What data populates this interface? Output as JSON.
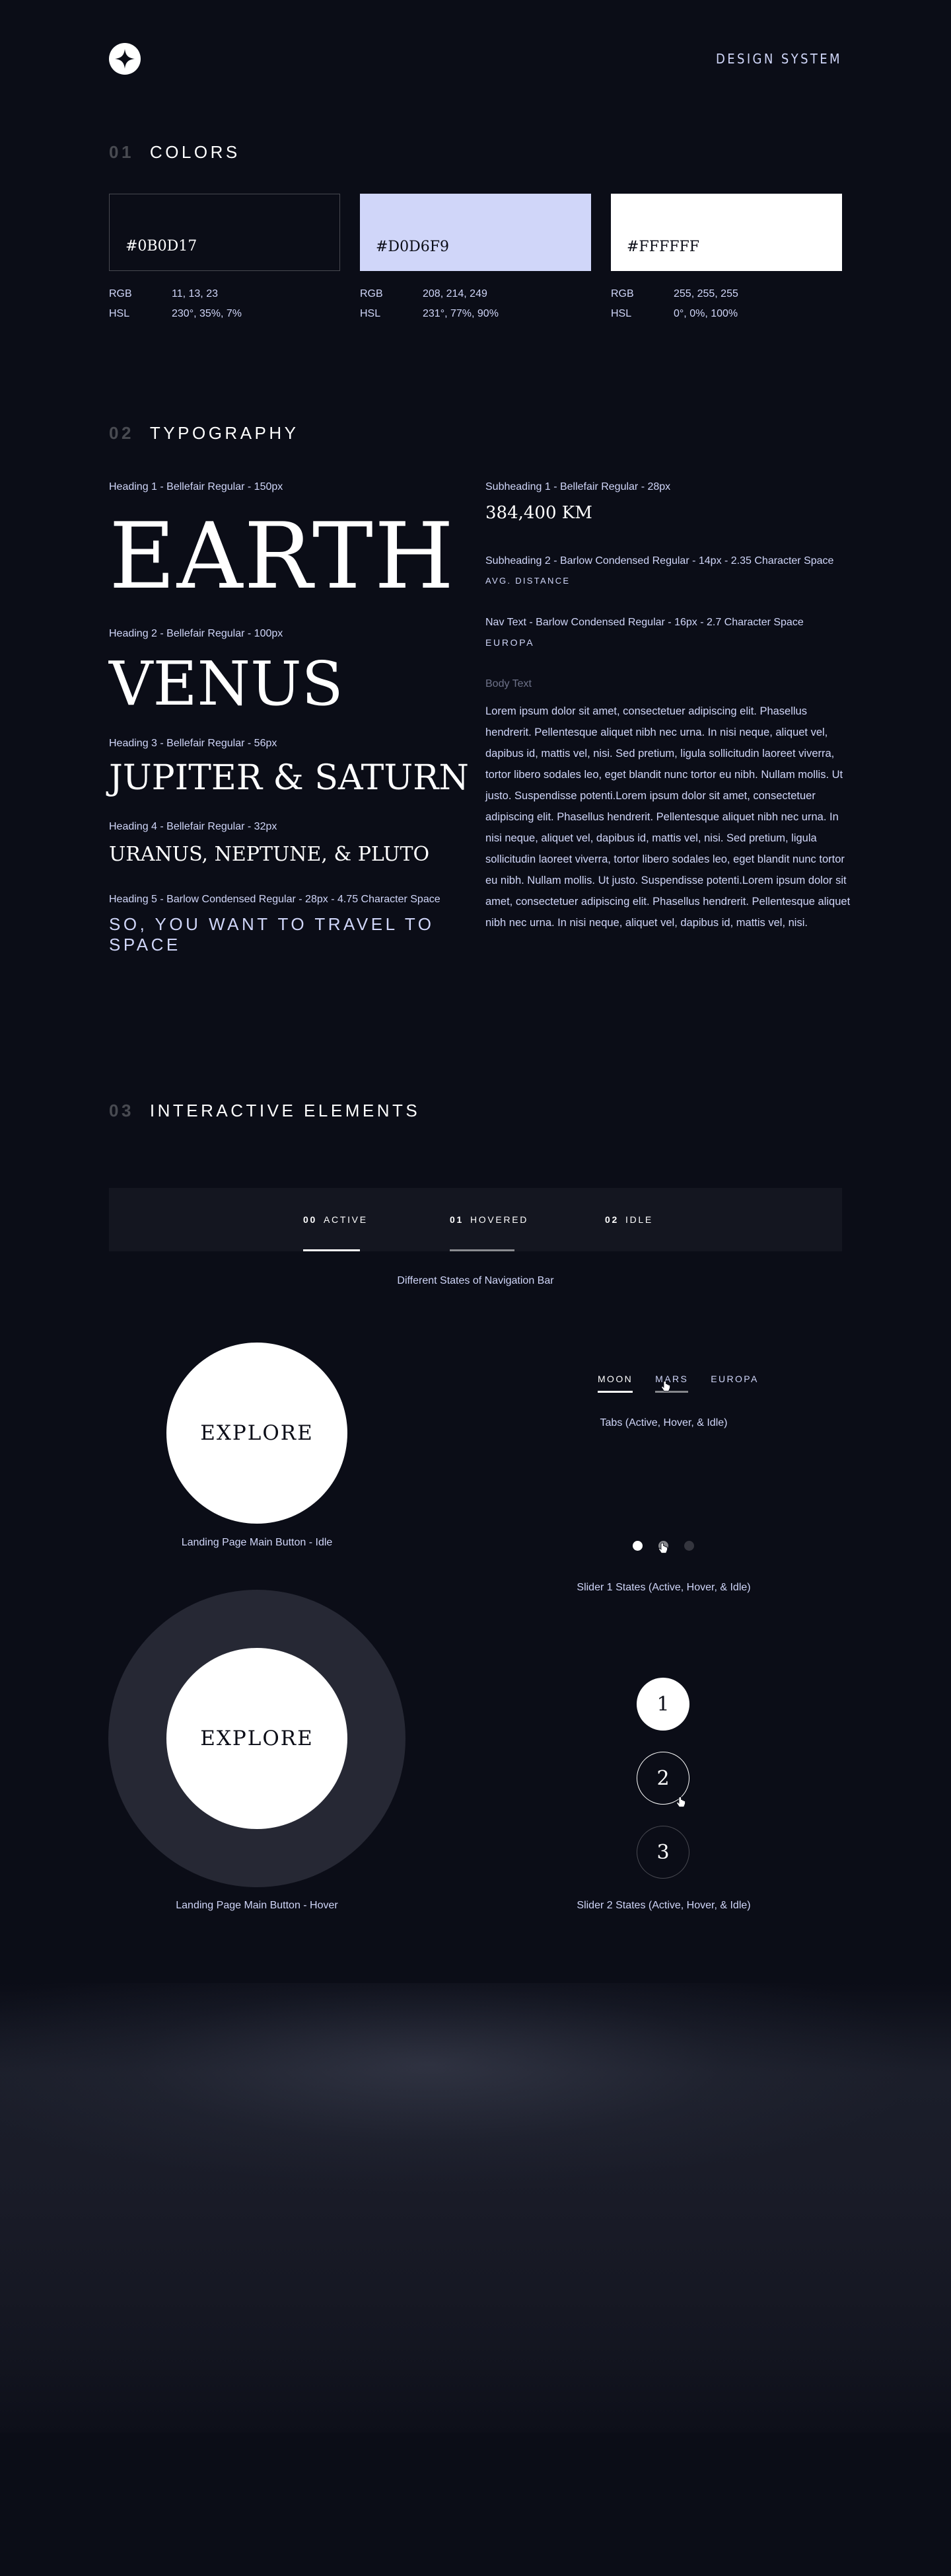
{
  "header": {
    "brand": "DESIGN SYSTEM",
    "logo_icon": "star-logo-icon"
  },
  "colors": {
    "num": "01",
    "title": "COLORS",
    "swatches": [
      {
        "hex": "#0B0D17",
        "rgb_label": "RGB",
        "rgb": "11, 13, 23",
        "hsl_label": "HSL",
        "hsl": "230°, 35%, 7%"
      },
      {
        "hex": "#D0D6F9",
        "rgb_label": "RGB",
        "rgb": "208, 214, 249",
        "hsl_label": "HSL",
        "hsl": "231°, 77%, 90%"
      },
      {
        "hex": "#FFFFFF",
        "rgb_label": "RGB",
        "rgb": "255, 255, 255",
        "hsl_label": "HSL",
        "hsl": "0°, 0%, 100%"
      }
    ]
  },
  "typography": {
    "num": "02",
    "title": "TYPOGRAPHY",
    "h1_label": "Heading 1 - Bellefair Regular - 150px",
    "h1": "EARTH",
    "h2_label": "Heading 2 - Bellefair Regular - 100px",
    "h2": "VENUS",
    "h3_label": "Heading 3 - Bellefair Regular - 56px",
    "h3": "JUPITER & SATURN",
    "h4_label": "Heading 4 - Bellefair Regular - 32px",
    "h4": "URANUS, NEPTUNE, & PLUTO",
    "h5_label": "Heading 5 - Barlow Condensed Regular - 28px - 4.75 Character Space",
    "h5": "SO, YOU WANT TO TRAVEL TO SPACE",
    "sub1_label": "Subheading 1 - Bellefair Regular - 28px",
    "sub1": "384,400 KM",
    "sub2_label": "Subheading 2 - Barlow Condensed Regular - 14px - 2.35 Character Space",
    "sub2": "AVG. DISTANCE",
    "nav_label": "Nav Text - Barlow Condensed Regular - 16px - 2.7 Character Space",
    "nav": "EUROPA",
    "body_label": "Body Text",
    "body": "Lorem ipsum dolor sit amet, consectetuer adipiscing elit. Phasellus hendrerit. Pellentesque aliquet nibh nec urna. In nisi neque, aliquet vel, dapibus id, mattis vel, nisi. Sed pretium, ligula sollicitudin laoreet viverra, tortor libero sodales leo, eget blandit nunc tortor eu nibh. Nullam mollis. Ut justo. Suspendisse potenti.Lorem ipsum dolor sit amet, consectetuer adipiscing elit. Phasellus hendrerit. Pellentesque aliquet nibh nec urna. In nisi neque, aliquet vel, dapibus id, mattis vel, nisi. Sed pretium, ligula sollicitudin laoreet viverra, tortor libero sodales leo, eget blandit nunc tortor eu nibh. Nullam mollis. Ut justo. Suspendisse potenti.Lorem ipsum dolor sit amet, consectetuer adipiscing elit. Phasellus hendrerit. Pellentesque aliquet nibh nec urna. In nisi neque, aliquet vel, dapibus id, mattis vel, nisi."
  },
  "interactive": {
    "num": "03",
    "title": "INTERACTIVE ELEMENTS",
    "nav_items": [
      {
        "num": "00",
        "label": "ACTIVE"
      },
      {
        "num": "01",
        "label": "HOVERED"
      },
      {
        "num": "02",
        "label": "IDLE"
      }
    ],
    "nav_caption": "Different States of Navigation Bar",
    "explore_label": "EXPLORE",
    "explore_idle_caption": "Landing Page Main Button - Idle",
    "explore_hover_caption": "Landing Page Main Button - Hover",
    "tabs": [
      "MOON",
      "MARS",
      "EUROPA"
    ],
    "tabs_caption": "Tabs (Active, Hover, & Idle)",
    "slider1_caption": "Slider 1 States (Active, Hover, & Idle)",
    "slider2_buttons": [
      "1",
      "2",
      "3"
    ],
    "slider2_caption": "Slider 2 States (Active, Hover, & Idle)"
  },
  "palette": {
    "dark": "#0B0D17",
    "light": "#D0D6F9",
    "white": "#FFFFFF"
  }
}
